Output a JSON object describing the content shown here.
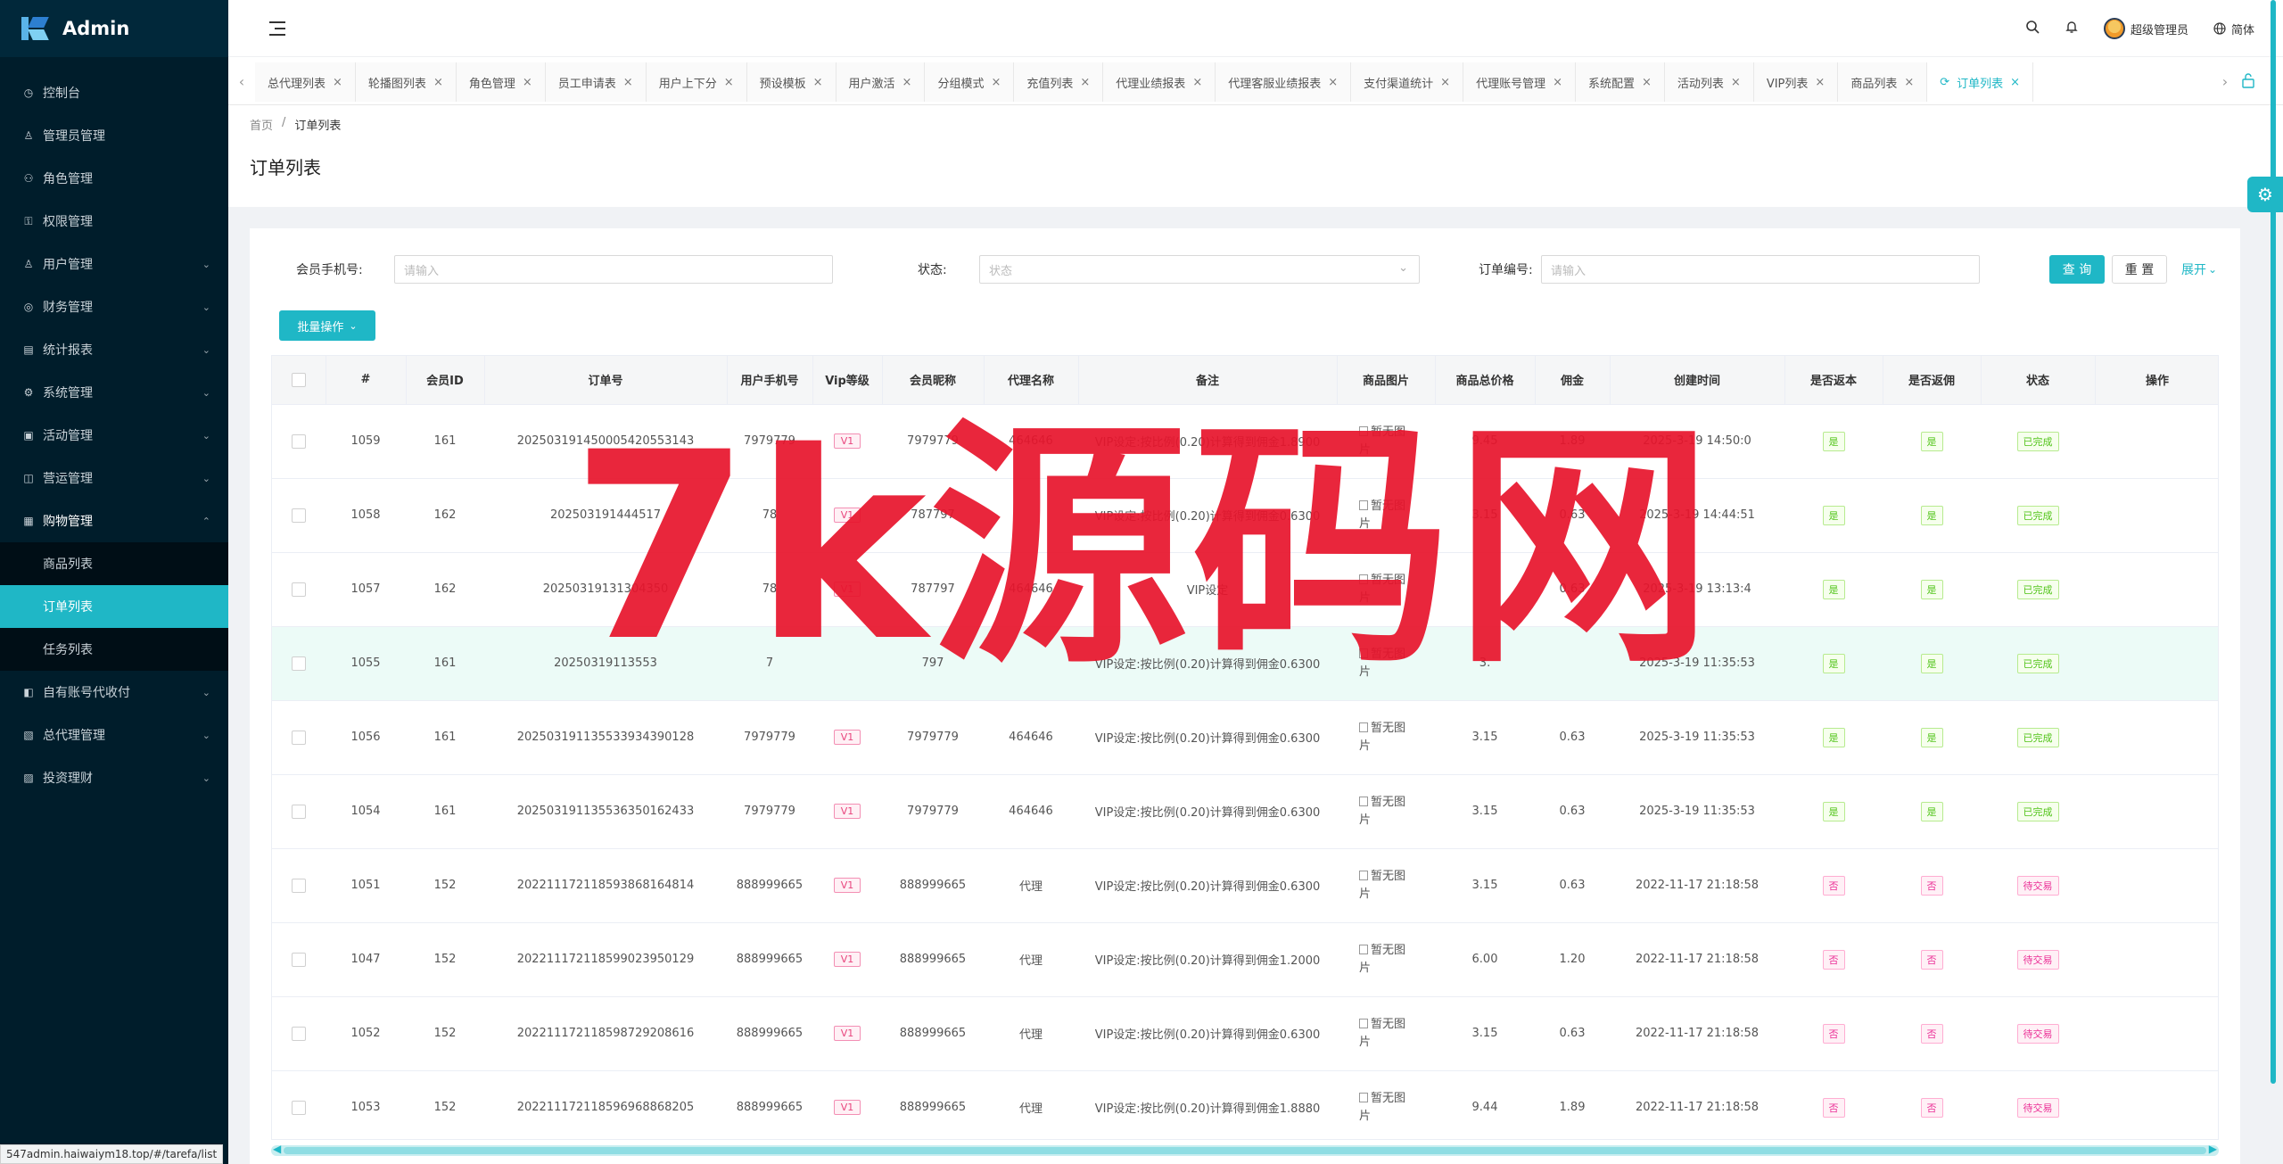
{
  "app": {
    "title": "Admin"
  },
  "sidebar": {
    "items": [
      {
        "label": "控制台",
        "icon": "clock-icon",
        "chev": ""
      },
      {
        "label": "管理员管理",
        "icon": "user-icon",
        "chev": ""
      },
      {
        "label": "角色管理",
        "icon": "role-icon",
        "chev": ""
      },
      {
        "label": "权限管理",
        "icon": "permission-icon",
        "chev": ""
      },
      {
        "label": "用户管理",
        "icon": "user-icon",
        "chev": "⌄"
      },
      {
        "label": "财务管理",
        "icon": "finance-icon",
        "chev": "⌄"
      },
      {
        "label": "统计报表",
        "icon": "chart-icon",
        "chev": "⌄"
      },
      {
        "label": "系统管理",
        "icon": "gear-icon",
        "chev": "⌄"
      },
      {
        "label": "活动管理",
        "icon": "gift-icon",
        "chev": "⌄"
      },
      {
        "label": "营运管理",
        "icon": "operation-icon",
        "chev": "⌄"
      },
      {
        "label": "购物管理",
        "icon": "shop-icon",
        "chev": "⌃"
      }
    ],
    "subitems": [
      {
        "label": "商品列表"
      },
      {
        "label": "订单列表"
      },
      {
        "label": "任务列表"
      }
    ],
    "items_after": [
      {
        "label": "自有账号代收付",
        "icon": "account-icon",
        "chev": "⌄"
      },
      {
        "label": "总代理管理",
        "icon": "agent-icon",
        "chev": "⌄"
      },
      {
        "label": "投资理财",
        "icon": "invest-icon",
        "chev": "⌄"
      }
    ]
  },
  "header": {
    "user": "超级管理员",
    "lang": "简体"
  },
  "tabs": [
    "总代理列表",
    "轮播图列表",
    "角色管理",
    "员工申请表",
    "用户上下分",
    "预设模板",
    "用户激活",
    "分组模式",
    "充值列表",
    "代理业绩报表",
    "代理客服业绩报表",
    "支付渠道统计",
    "代理账号管理",
    "系统配置",
    "活动列表",
    "VIP列表",
    "商品列表",
    "订单列表"
  ],
  "breadcrumb": {
    "home": "首页",
    "sep": "/",
    "current": "订单列表"
  },
  "page": {
    "title": "订单列表"
  },
  "filters": {
    "phone_label": "会员手机号:",
    "phone_placeholder": "请输入",
    "status_label": "状态:",
    "status_placeholder": "状态",
    "order_label": "订单编号:",
    "order_placeholder": "请输入",
    "search": "查 询",
    "reset": "重 置",
    "expand": "展开"
  },
  "batch": {
    "label": "批量操作"
  },
  "table": {
    "headers": [
      "#",
      "会员ID",
      "订单号",
      "用户手机号",
      "Vip等级",
      "会员昵称",
      "代理名称",
      "备注",
      "商品图片",
      "商品总价格",
      "佣金",
      "创建时间",
      "是否返本",
      "是否返佣",
      "状态",
      "操作"
    ],
    "img_placeholder": "暂无图片",
    "rows": [
      {
        "id": "1059",
        "member": "161",
        "order": "2025031914500054205531​43",
        "phone": "7979779",
        "vip": "V1",
        "nick": "7979779",
        "agent": "464646",
        "remark": "VIP设定:按比例(0.20)计算得到佣金1.8900",
        "price": "9.45",
        "commission": "1.89",
        "time": "2025-3-19 14:50:0",
        "ret": "是",
        "rebate": "是",
        "status": "已完成",
        "done": true
      },
      {
        "id": "1058",
        "member": "162",
        "order": "202503191444517",
        "phone": "78",
        "vip": "V1",
        "nick": "787797",
        "agent": "",
        "remark": "VIP设定:按比例(0.20)计算得到佣金0.6300",
        "price": "3.15",
        "commission": "0.63",
        "time": "2025-3-19 14:44:51",
        "ret": "是",
        "rebate": "是",
        "status": "已完成",
        "done": true
      },
      {
        "id": "1057",
        "member": "162",
        "order": "20250319131304350",
        "phone": "78",
        "vip": "V1",
        "nick": "787797",
        "agent": "464646",
        "remark": "VIP设定",
        "price": "",
        "commission": "0.63",
        "time": "2025-3-19 13:13:4",
        "ret": "是",
        "rebate": "是",
        "status": "已完成",
        "done": true
      },
      {
        "id": "1055",
        "member": "161",
        "order": "20250319113553",
        "phone": "7",
        "vip": "",
        "nick": "797",
        "agent": "",
        "remark": "VIP设定:按比例(0.20)计算得到佣金0.6300",
        "price": "3.",
        "commission": "",
        "time": "2025-3-19 11:35:53",
        "ret": "是",
        "rebate": "是",
        "status": "已完成",
        "done": true
      },
      {
        "id": "1056",
        "member": "161",
        "order": "2025031911355339343901​28",
        "phone": "7979779",
        "vip": "V1",
        "nick": "7979779",
        "agent": "464646",
        "remark": "VIP设定:按比例(0.20)计算得到佣金0.6300",
        "price": "3.15",
        "commission": "0.63",
        "time": "2025-3-19 11:35:53",
        "ret": "是",
        "rebate": "是",
        "status": "已完成",
        "done": true
      },
      {
        "id": "1054",
        "member": "161",
        "order": "2025031911355363501624​33",
        "phone": "7979779",
        "vip": "V1",
        "nick": "7979779",
        "agent": "464646",
        "remark": "VIP设定:按比例(0.20)计算得到佣金0.6300",
        "price": "3.15",
        "commission": "0.63",
        "time": "2025-3-19 11:35:53",
        "ret": "是",
        "rebate": "是",
        "status": "已完成",
        "done": true
      },
      {
        "id": "1051",
        "member": "152",
        "order": "2022111721185938681648​14",
        "phone": "888999665",
        "vip": "V1",
        "nick": "888999665",
        "agent": "代理",
        "remark": "VIP设定:按比例(0.20)计算得到佣金0.6300",
        "price": "3.15",
        "commission": "0.63",
        "time": "2022-11-17 21:18:58",
        "ret": "否",
        "rebate": "否",
        "status": "待交易",
        "done": false
      },
      {
        "id": "1047",
        "member": "152",
        "order": "2022111721185990239501​29",
        "phone": "888999665",
        "vip": "V1",
        "nick": "888999665",
        "agent": "代理",
        "remark": "VIP设定:按比例(0.20)计算得到佣金1.2000",
        "price": "6.00",
        "commission": "1.20",
        "time": "2022-11-17 21:18:58",
        "ret": "否",
        "rebate": "否",
        "status": "待交易",
        "done": false
      },
      {
        "id": "1052",
        "member": "152",
        "order": "2022111721185987292086​16",
        "phone": "888999665",
        "vip": "V1",
        "nick": "888999665",
        "agent": "代理",
        "remark": "VIP设定:按比例(0.20)计算得到佣金0.6300",
        "price": "3.15",
        "commission": "0.63",
        "time": "2022-11-17 21:18:58",
        "ret": "否",
        "rebate": "否",
        "status": "待交易",
        "done": false
      },
      {
        "id": "1053",
        "member": "152",
        "order": "2022111721185969688682​05",
        "phone": "888999665",
        "vip": "V1",
        "nick": "888999665",
        "agent": "代理",
        "remark": "VIP设定:按比例(0.20)计算得到佣金1.8880",
        "price": "9.44",
        "commission": "1.89",
        "time": "2022-11-17 21:18:58",
        "ret": "否",
        "rebate": "否",
        "status": "待交易",
        "done": false
      }
    ]
  },
  "statusbar": {
    "url": "547admin.haiwaiym18.top/#/tarefa/list"
  },
  "watermark": {
    "text": "7k源码网"
  },
  "colors": {
    "accent": "#1fb7c6",
    "sidebar": "#001d2b",
    "watermark": "#e8142c"
  }
}
